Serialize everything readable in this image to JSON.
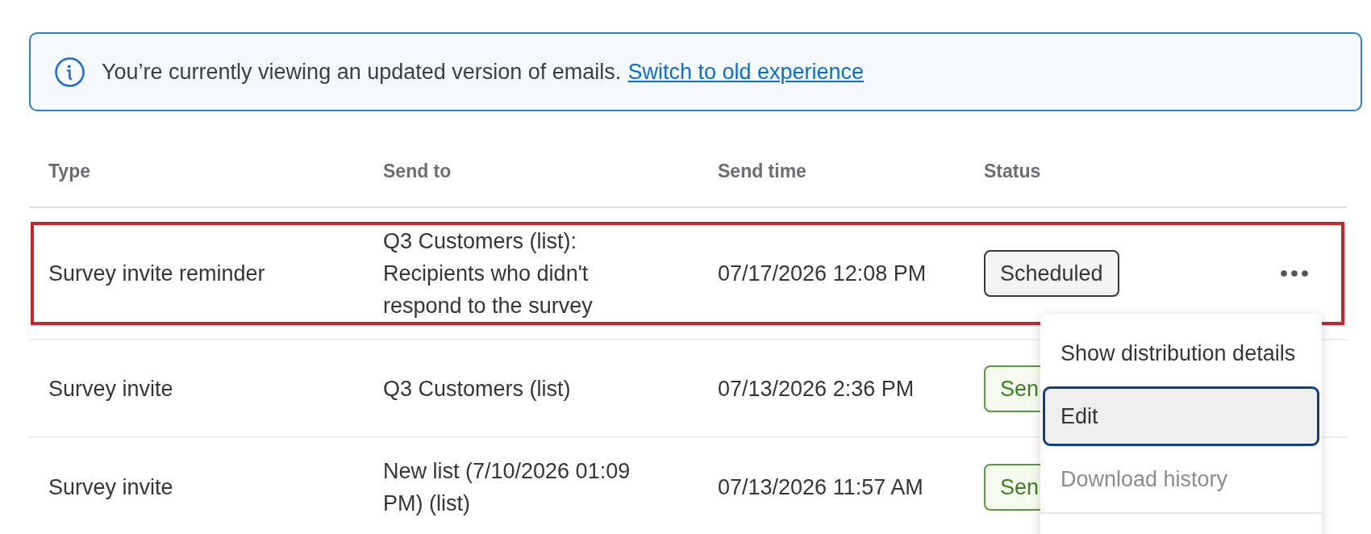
{
  "banner": {
    "message": "You’re currently viewing an updated version of emails.",
    "link": "Switch to old experience"
  },
  "table": {
    "columns": [
      "Type",
      "Send to",
      "Send time",
      "Status"
    ],
    "rows": [
      {
        "type": "Survey invite reminder",
        "send_to": "Q3 Customers (list): Recipients who didn't respond to the survey",
        "send_time": "07/17/2026 12:08 PM",
        "status": {
          "label": "Scheduled",
          "kind": "scheduled"
        },
        "highlighted": true,
        "menu_open": true
      },
      {
        "type": "Survey invite",
        "send_to": "Q3 Customers (list)",
        "send_time": "07/13/2026 2:36 PM",
        "status": {
          "label": "Sen",
          "kind": "sent"
        },
        "highlighted": false,
        "menu_open": false
      },
      {
        "type": "Survey invite",
        "send_to": "New list (7/10/2026 01:09 PM) (list)",
        "send_time": "07/13/2026 11:57 AM",
        "status": {
          "label": "Sen",
          "kind": "sent"
        },
        "highlighted": false,
        "menu_open": false
      }
    ]
  },
  "menu": {
    "items": [
      {
        "label": "Show distribution details",
        "selected": false,
        "disabled": false
      },
      {
        "label": "Edit",
        "selected": true,
        "disabled": false
      },
      {
        "label": "Download history",
        "selected": false,
        "disabled": true
      }
    ]
  }
}
